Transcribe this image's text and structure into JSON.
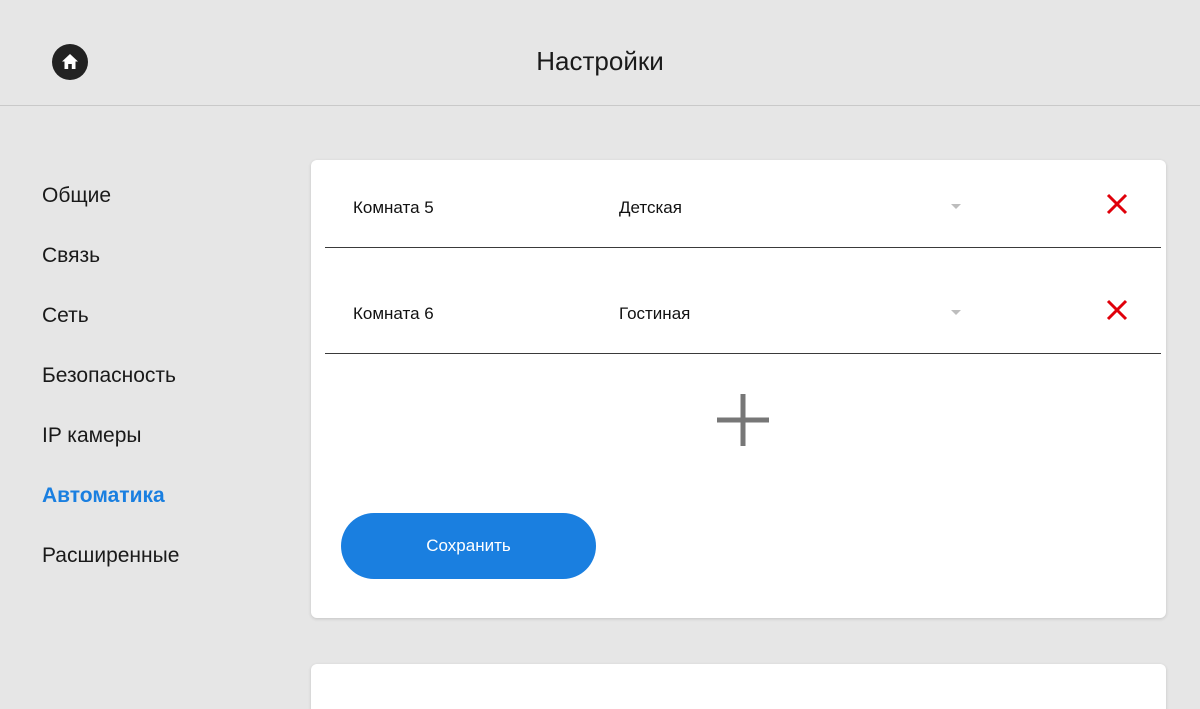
{
  "header": {
    "title": "Настройки",
    "home_icon": "home-icon"
  },
  "sidebar": {
    "items": [
      {
        "label": "Общие",
        "active": false
      },
      {
        "label": "Связь",
        "active": false
      },
      {
        "label": "Сеть",
        "active": false
      },
      {
        "label": "Безопасность",
        "active": false
      },
      {
        "label": "IP камеры",
        "active": false
      },
      {
        "label": "Автоматика",
        "active": true
      },
      {
        "label": "Расширенные",
        "active": false
      }
    ]
  },
  "rooms": [
    {
      "label": "Комната 5",
      "selected": "Детская",
      "delete_icon": "close-icon"
    },
    {
      "label": "Комната 6",
      "selected": "Гостиная",
      "delete_icon": "close-icon"
    }
  ],
  "add_icon": "plus-icon",
  "save_label": "Сохранить",
  "colors": {
    "accent": "#1a7fe0",
    "delete": "#e0000a",
    "background": "#e6e6e6",
    "card": "#ffffff"
  }
}
